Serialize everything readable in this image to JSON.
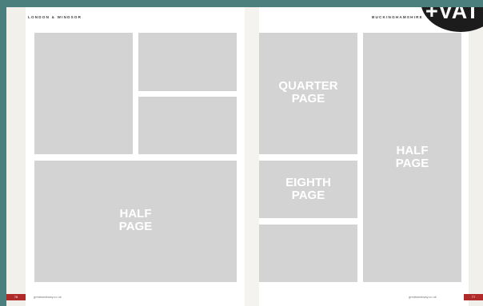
{
  "left_page": {
    "running_head": "LONDON & WINDSOR",
    "page_number": "76",
    "footer_url": "greatwestway.co.uk",
    "half_page_label": "HALF\nPAGE"
  },
  "right_page": {
    "running_head": "BUCKINGHAMSHIRE",
    "page_number": "77",
    "footer_url": "greatwestway.co.uk",
    "quarter_page_label": "QUARTER\nPAGE",
    "eighth_page_label": "EIGHTH\nPAGE",
    "half_page_label": "HALF\nPAGE"
  },
  "badge": {
    "text": "+VAT"
  },
  "colors": {
    "background": "#4a7f7e",
    "placeholder": "#d3d3d4",
    "folio_tab": "#b02a2a",
    "badge": "#1c1c1c"
  }
}
